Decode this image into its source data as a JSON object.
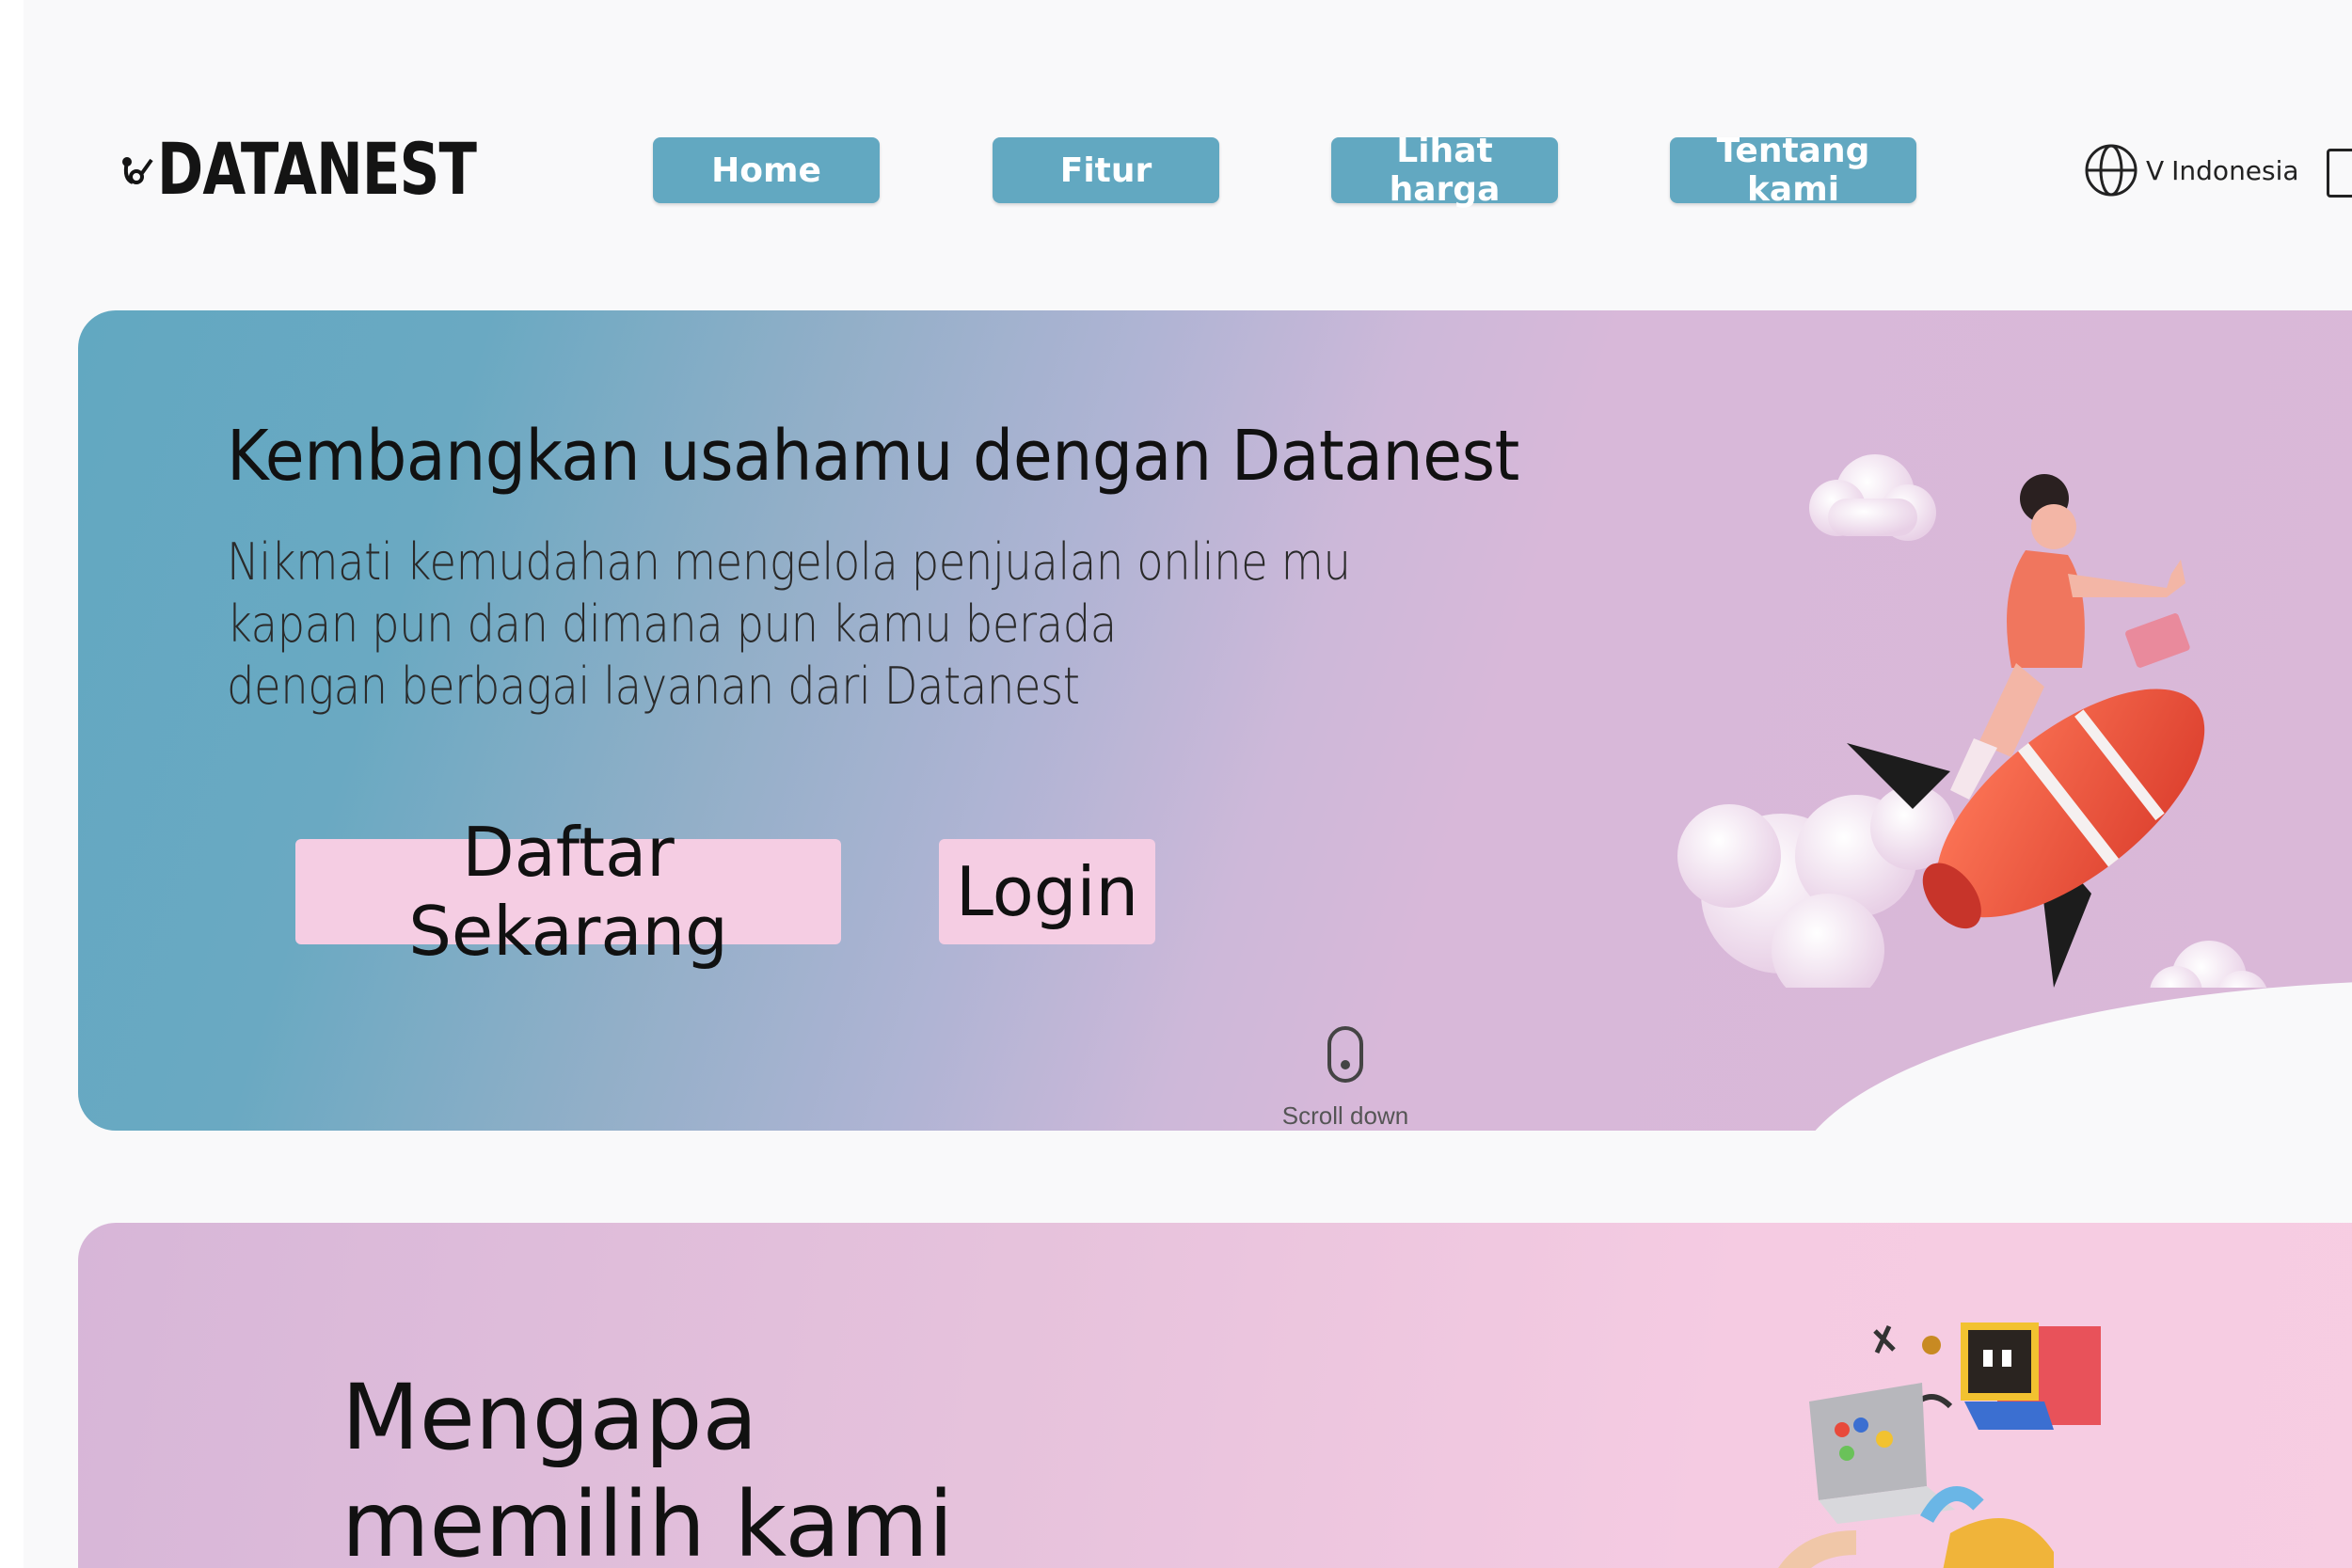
{
  "brand": {
    "name": "DATANEST"
  },
  "nav": {
    "items": [
      {
        "label": "Home"
      },
      {
        "label": "Fitur"
      },
      {
        "label": "Lihat harga"
      },
      {
        "label": "Tentang kami"
      }
    ],
    "language": {
      "prefix": "V",
      "label": "Indonesia",
      "icon": "globe-icon"
    }
  },
  "hero": {
    "title": "Kembangkan usahamu dengan Datanest",
    "subtitle_lines": [
      "Nikmati kemudahan mengelola penjualan online mu",
      "kapan pun dan dimana pun kamu berada",
      "dengan berbagai layanan dari Datanest"
    ],
    "primary_cta": "Daftar Sekarang",
    "secondary_cta": "Login",
    "scroll_label": "Scroll down",
    "illustration": "rocket-rider-illustration"
  },
  "why": {
    "title_lines": [
      "Mengapa",
      "memilih kami"
    ],
    "illustration": "laptop-apps-illustration"
  },
  "colors": {
    "nav_button": "#62a8c1",
    "cta_button": "#f5cde3",
    "hero_gradient_start": "#62a8c1",
    "hero_gradient_end": "#dab8d8",
    "why_gradient_end": "#f7cde2"
  }
}
